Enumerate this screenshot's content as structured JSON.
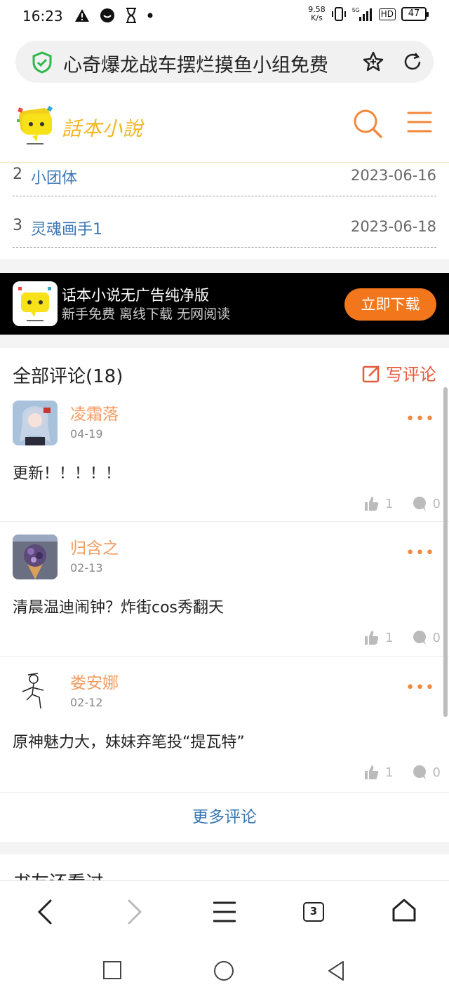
{
  "status_bar": {
    "time": "16:23",
    "speed": "9.58",
    "speed_unit": "K/s",
    "network": "5G",
    "hd": "HD",
    "battery": "47"
  },
  "url_bar": {
    "url_text": "心奇爆龙战车摆烂摸鱼小组免费",
    "secure_icon": "shield-check-icon",
    "accent_color": "#2db84c"
  },
  "site_header": {
    "logo_text": "話本小說"
  },
  "chapters": [
    {
      "num": "2",
      "title": "小团体",
      "date": "2023-06-16"
    },
    {
      "num": "3",
      "title": "灵魂画手1",
      "date": "2023-06-18"
    }
  ],
  "ad_banner": {
    "title": "话本小说无广告纯净版",
    "subtitle": "新手免费 离线下载 无网阅读",
    "button": "立即下载"
  },
  "comments": {
    "title": "全部评论(18)",
    "write_label": "写评论",
    "more_link": "更多评论",
    "items": [
      {
        "user": "凌霜落",
        "date": "04-19",
        "text": "更新！！！！！",
        "likes": "1",
        "replies": "0"
      },
      {
        "user": "归含之",
        "date": "02-13",
        "text": "清晨温迪闹钟？炸街cos秀翻天",
        "likes": "1",
        "replies": "0"
      },
      {
        "user": "娄安娜",
        "date": "02-12",
        "text": "原神魅力大，妹妹弃笔投“提瓦特”",
        "likes": "1",
        "replies": "0"
      }
    ]
  },
  "next_section": {
    "title": "书友还看过"
  },
  "browser_toolbar": {
    "tab_count": "3"
  },
  "colors": {
    "brand": "#f2b51c",
    "accent_orange": "#f2761c",
    "link_blue": "#3a77b5"
  }
}
